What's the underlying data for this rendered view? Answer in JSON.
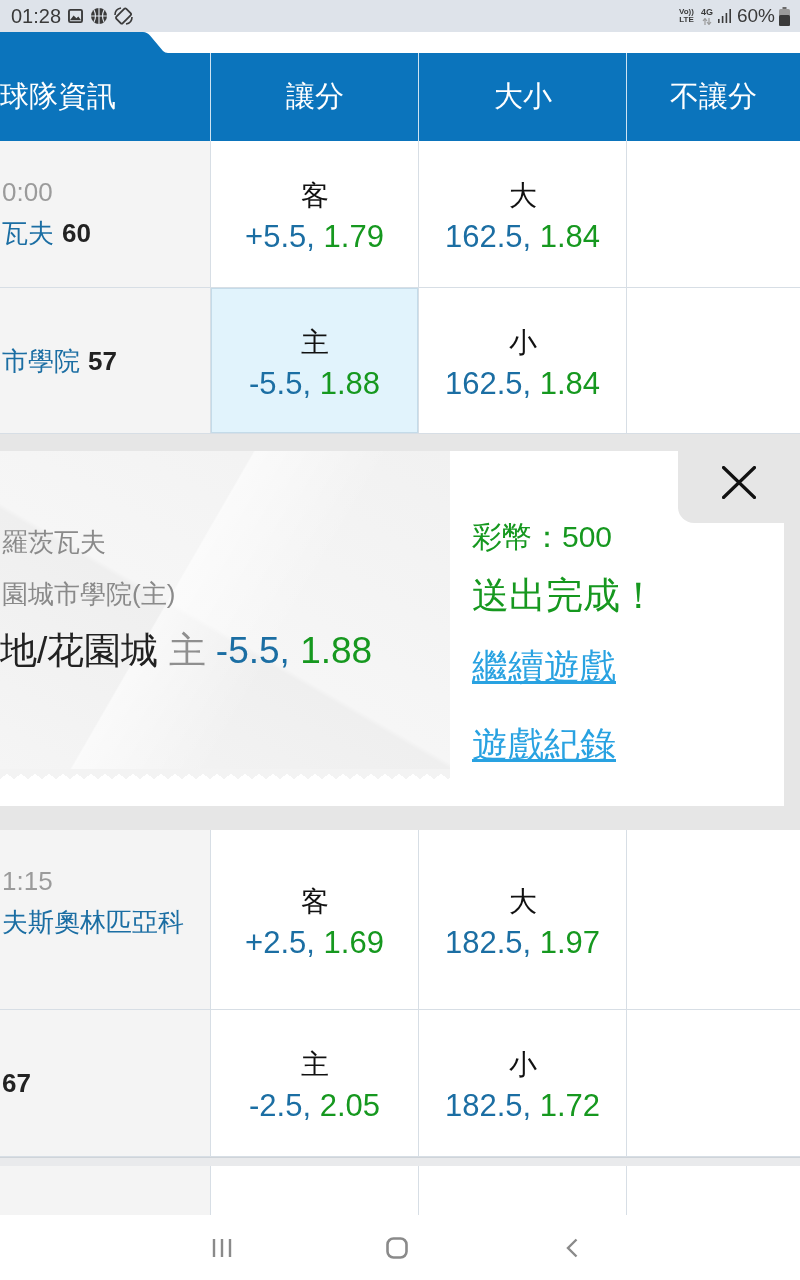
{
  "status_bar": {
    "time": "01:28",
    "volte": [
      "Vo))",
      "LTE"
    ],
    "network": "4G",
    "battery": "60%"
  },
  "table": {
    "columns": [
      "球隊資訊",
      "讓分",
      "大小",
      "不讓分"
    ],
    "sections": [
      {
        "kind": "match",
        "rows": [
          {
            "time": "0:00",
            "team": "瓦夫",
            "score": "60",
            "bets": [
              {
                "side": "客",
                "line": "+5.5,",
                "odds": "1.79",
                "selected": false
              },
              {
                "side": "大",
                "line": "162.5,",
                "odds": "1.84",
                "selected": false
              }
            ]
          },
          {
            "team": "市學院",
            "score": "57",
            "bets": [
              {
                "side": "主",
                "line": "-5.5,",
                "odds": "1.88",
                "selected": true
              },
              {
                "side": "小",
                "line": "162.5,",
                "odds": "1.84",
                "selected": false
              }
            ]
          }
        ]
      },
      {
        "kind": "bet_slip",
        "away_team": "羅茨瓦夫",
        "home_team": "園城市學院(主)",
        "pick": {
          "selection": "地/花園城",
          "side": "主",
          "line": "-5.5,",
          "odds": "1.88"
        },
        "coins": "彩幣：500",
        "status": "送出完成！",
        "links": [
          "繼續遊戲",
          "遊戲紀錄"
        ]
      },
      {
        "kind": "match",
        "rows": [
          {
            "time": "1:15",
            "team": "夫斯奧林匹亞科",
            "bets": [
              {
                "side": "客",
                "line": "+2.5,",
                "odds": "1.69",
                "selected": false
              },
              {
                "side": "大",
                "line": "182.5,",
                "odds": "1.97",
                "selected": false
              }
            ]
          },
          {
            "score": "67",
            "bets": [
              {
                "side": "主",
                "line": "-2.5,",
                "odds": "2.05",
                "selected": false
              },
              {
                "side": "小",
                "line": "182.5,",
                "odds": "1.72",
                "selected": false
              }
            ]
          }
        ]
      }
    ]
  }
}
